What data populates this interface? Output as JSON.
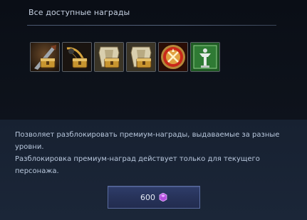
{
  "header": {
    "title": "Все доступные награды"
  },
  "rewards": [
    {
      "icon": "weapon-chest-icon",
      "accent": "#c89a3a"
    },
    {
      "icon": "bow-chest-icon",
      "accent": "#b7862e"
    },
    {
      "icon": "armor-chest-icon",
      "accent": "#d8c9a0"
    },
    {
      "icon": "armor-chest-icon",
      "accent": "#d8c9a0"
    },
    {
      "icon": "crossed-swords-emblem-icon",
      "accent": "#c92a1a"
    },
    {
      "icon": "green-statue-icon",
      "accent": "#3f8a3a"
    }
  ],
  "description": {
    "line1": "Позволяет разблокировать премиум-награды, выдаваемые за разные уровни.",
    "line2": "Разблокировка премиум-наград действует только для текущего персонажа."
  },
  "purchase": {
    "price": "600",
    "currency_icon": "purple-gem-icon",
    "currency_color": "#b34fe0"
  }
}
